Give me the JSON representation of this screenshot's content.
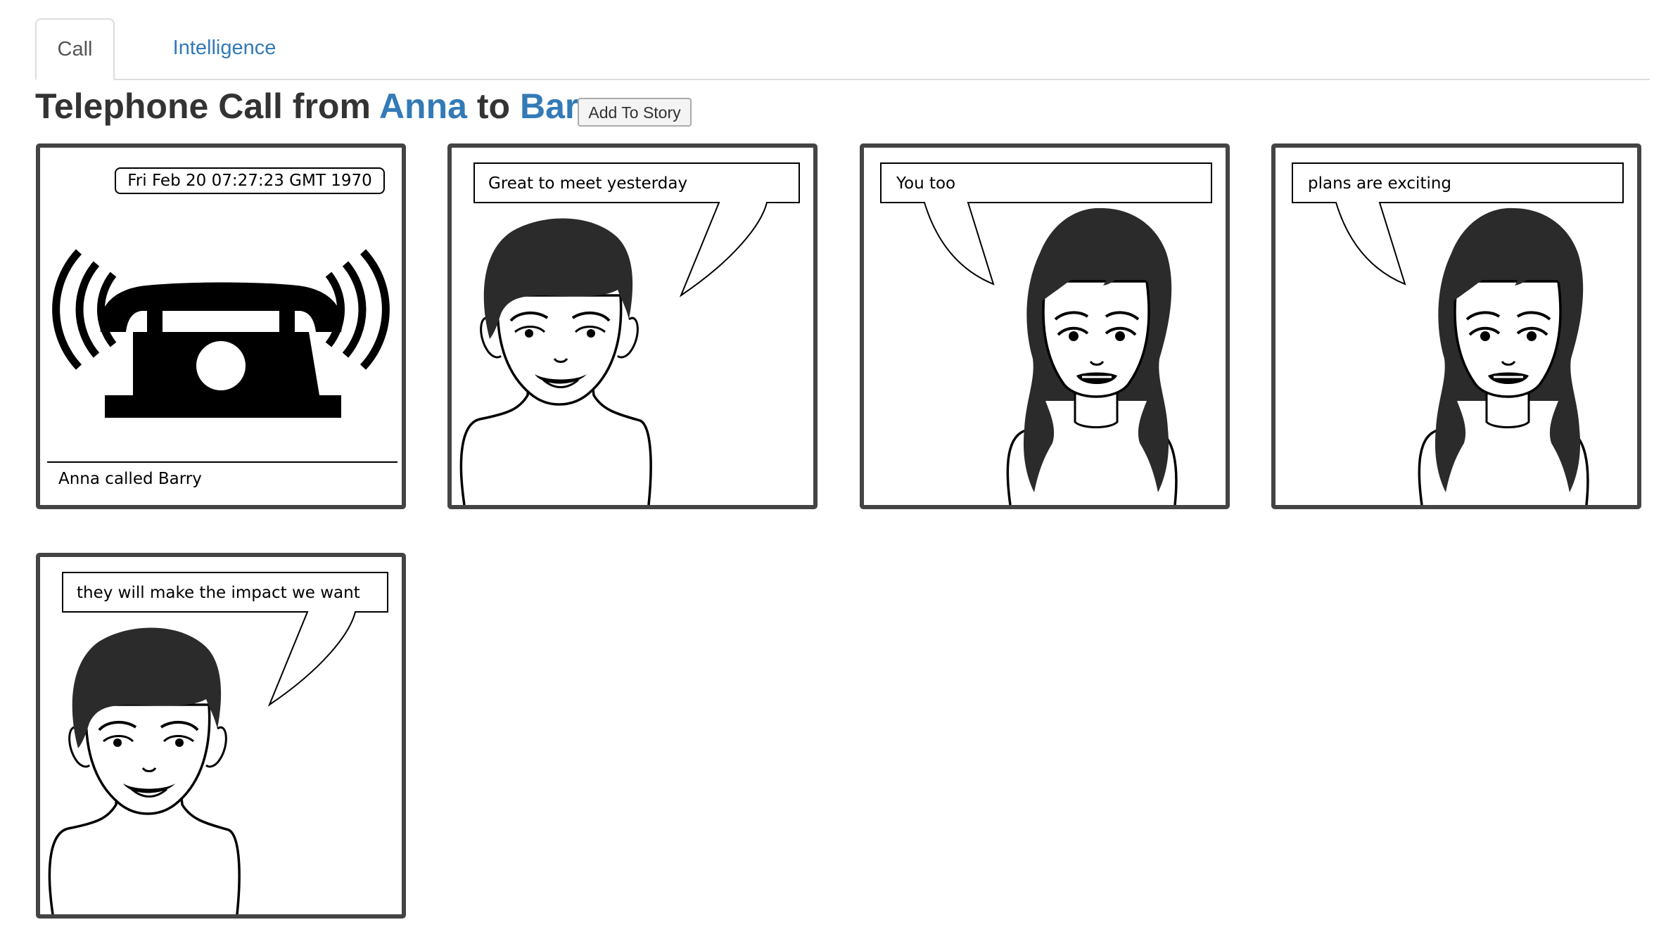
{
  "tabs": [
    {
      "label": "Call",
      "active": true
    },
    {
      "label": "Intelligence",
      "active": false
    }
  ],
  "heading": {
    "prefix": "Telephone Call from",
    "caller": "Anna",
    "joiner": "to",
    "callee": "Barry",
    "add_button": "Add To Story"
  },
  "panels": {
    "intro": {
      "timestamp": "Fri Feb 20 07:27:23 GMT 1970",
      "caption": "Anna called Barry",
      "icon": "ringing-telephone-icon"
    },
    "dialogue": [
      {
        "speaker": "male",
        "text": "Great to meet yesterday"
      },
      {
        "speaker": "female",
        "text": "You too"
      },
      {
        "speaker": "female",
        "text": "plans are exciting"
      },
      {
        "speaker": "male",
        "text": "they will make the impact we want"
      }
    ]
  },
  "colors": {
    "link": "#337ab7",
    "panel_border": "#444444",
    "hair": "#2b2b2b"
  }
}
